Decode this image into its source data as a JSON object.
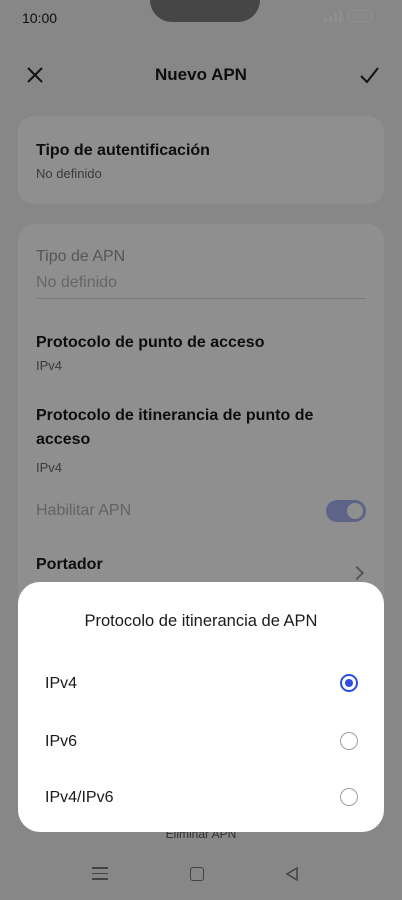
{
  "status_bar": {
    "time": "10:00",
    "battery": "100"
  },
  "top_bar": {
    "title": "Nuevo APN",
    "close_icon": "close-icon",
    "confirm_icon": "check-icon"
  },
  "auth": {
    "label": "Tipo de autentificación",
    "value": "No definido"
  },
  "form": {
    "apn_type_label": "Tipo de APN",
    "apn_type_placeholder": "No definido",
    "protocol_label": "Protocolo de punto de acceso",
    "protocol_value": "IPv4",
    "roaming_protocol_label": "Protocolo de itinerancia de punto de acceso",
    "roaming_protocol_value": "IPv4",
    "enable_apn_label": "Habilitar APN",
    "enable_apn_on": true,
    "carrier_label": "Portador"
  },
  "bottom": {
    "delete_label": "Eliminar APN"
  },
  "dialog": {
    "title": "Protocolo de itinerancia de APN",
    "options": [
      {
        "label": "IPv4",
        "selected": true
      },
      {
        "label": "IPv6",
        "selected": false
      },
      {
        "label": "IPv4/IPv6",
        "selected": false
      }
    ]
  },
  "colors": {
    "accent": "#2f4de3",
    "background": "#f0f0f0"
  }
}
